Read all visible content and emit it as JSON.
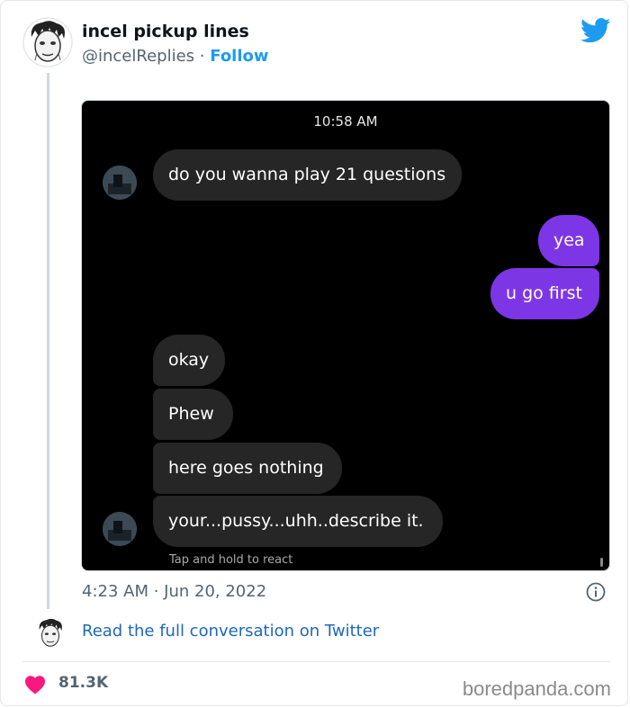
{
  "tweet": {
    "author_name": "incel pickup lines",
    "author_handle": "@incelReplies",
    "separator": "·",
    "follow_label": "Follow",
    "timestamp": "4:23 AM · Jun 20, 2022",
    "read_link": "Read the full conversation on Twitter",
    "likes": "81.3K"
  },
  "chat": {
    "time": "10:58 AM",
    "messages": [
      {
        "text": "do you wanna play 21 questions",
        "side": "received"
      },
      {
        "text": "yea",
        "side": "sent"
      },
      {
        "text": "u go first",
        "side": "sent"
      },
      {
        "text": "okay",
        "side": "received"
      },
      {
        "text": "Phew",
        "side": "received"
      },
      {
        "text": "here goes nothing",
        "side": "received"
      },
      {
        "text": "your...pussy...uhh..describe it.",
        "side": "received"
      }
    ],
    "hint": "Tap and hold to react"
  },
  "watermark": "boredpanda.com",
  "icons": {
    "brand": "twitter-bird-icon",
    "info": "info-icon",
    "like": "heart-icon"
  },
  "colors": {
    "twitter_blue": "#1d9bf0",
    "sent_bubble": "#7d36e6",
    "received_bubble": "#262626",
    "heart": "#f91880"
  }
}
